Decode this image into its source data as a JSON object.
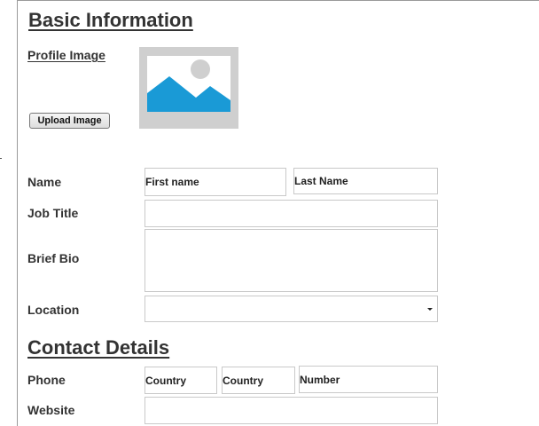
{
  "basic_info": {
    "title": "Basic Information",
    "profile_image_label": "Profile Image",
    "upload_button": "Upload Image",
    "profile_image_icon": "image-placeholder-icon",
    "colors": {
      "placeholder_frame": "#cfcfcf",
      "sky": "#ffffff",
      "hills": "#1a9ad6",
      "sun": "#cfcfcf"
    }
  },
  "fields": {
    "name_label": "Name",
    "first_name_placeholder": "First name",
    "last_name_placeholder": "Last Name",
    "job_title_label": "Job Title",
    "job_title_value": "",
    "brief_bio_label": "Brief Bio",
    "brief_bio_value": "",
    "location_label": "Location",
    "location_selected": "",
    "location_icon": "chevron-down-icon"
  },
  "contact": {
    "title": "Contact Details",
    "phone_label": "Phone",
    "phone_country_1_placeholder": "Country",
    "phone_country_2_placeholder": "Country",
    "phone_number_placeholder": "Number",
    "website_label": "Website",
    "website_value": ""
  }
}
